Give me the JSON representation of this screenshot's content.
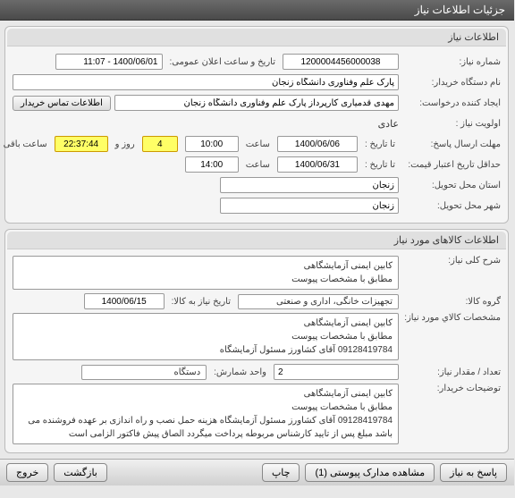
{
  "header": {
    "title": "جزئیات اطلاعات نیاز"
  },
  "section1": {
    "title": "اطلاعات نیاز",
    "fields": {
      "need_no_label": "شماره نیاز:",
      "need_no": "1200004456000038",
      "announce_label": "تاریخ و ساعت اعلان عمومی:",
      "announce_value": "1400/06/01 - 11:07",
      "buyer_label": "نام دستگاه خریدار:",
      "buyer_value": "پارک علم وفناوری دانشگاه زنجان",
      "creator_label": "ایجاد کننده درخواست:",
      "creator_value": "مهدی قدمیاری کارپرداز پارک علم وفناوری دانشگاه زنجان",
      "contact_btn": "اطلاعات تماس خریدار",
      "priority_label": "اولویت نیاز :",
      "priority_value": "عادی",
      "reply_deadline_label": "مهلت ارسال پاسخ:",
      "to_date_label": "تا تاریخ :",
      "date1": "1400/06/06",
      "time_label": "ساعت",
      "time1": "10:00",
      "days_remaining": "4",
      "days_label": "روز و",
      "time_remaining": "22:37:44",
      "remaining_label": "ساعت باقی مانده",
      "price_credit_label": "حداقل تاریخ اعتبار قیمت:",
      "date2": "1400/06/31",
      "time2": "14:00",
      "province_label": "استان محل تحویل:",
      "province_value": "زنجان",
      "city_label": "شهر محل تحویل:",
      "city_value": "زنجان"
    }
  },
  "section2": {
    "title": "اطلاعات کالاهای مورد نیاز",
    "fields": {
      "general_desc_label": "شرح کلی نیاز:",
      "general_desc": "کابین ایمنی آزمایشگاهی\nمطابق با مشخصات پیوست",
      "goods_group_label": "گروه کالا:",
      "goods_group": "تجهیزات خانگی، اداری و صنعتی",
      "need_date_label": "تاریخ نیاز به کالا:",
      "need_date": "1400/06/15",
      "specs_label": "مشخصات کالاي مورد نیاز:",
      "specs": "کابین ایمنی آزمایشگاهی\nمطابق با مشخصات پیوست\n09128419784 آقای کشاورز مسئول آزمایشگاه",
      "qty_label": "تعداد / مقدار نیاز:",
      "qty": "2",
      "unit_label": "واحد شمارش:",
      "unit": "دستگاه",
      "notes_label": "توضیحات خریدار:",
      "notes": "کابین ایمنی آزمایشگاهی\nمطابق با مشخصات پیوست\n09128419784 آقای کشاورز مسئول آزمایشگاه هزینه حمل نصب و راه اندازی بر عهده فروشنده می باشد مبلغ پس از تایید کارشناس مربوطه پرداخت میگردد الصاق پیش فاکتور الزامی است"
    }
  },
  "footer": {
    "reply_btn": "پاسخ به نیاز",
    "attachments_btn": "مشاهده مدارک پیوستی (1)",
    "print_btn": "چاپ",
    "back_btn": "بازگشت",
    "exit_btn": "خروج"
  }
}
